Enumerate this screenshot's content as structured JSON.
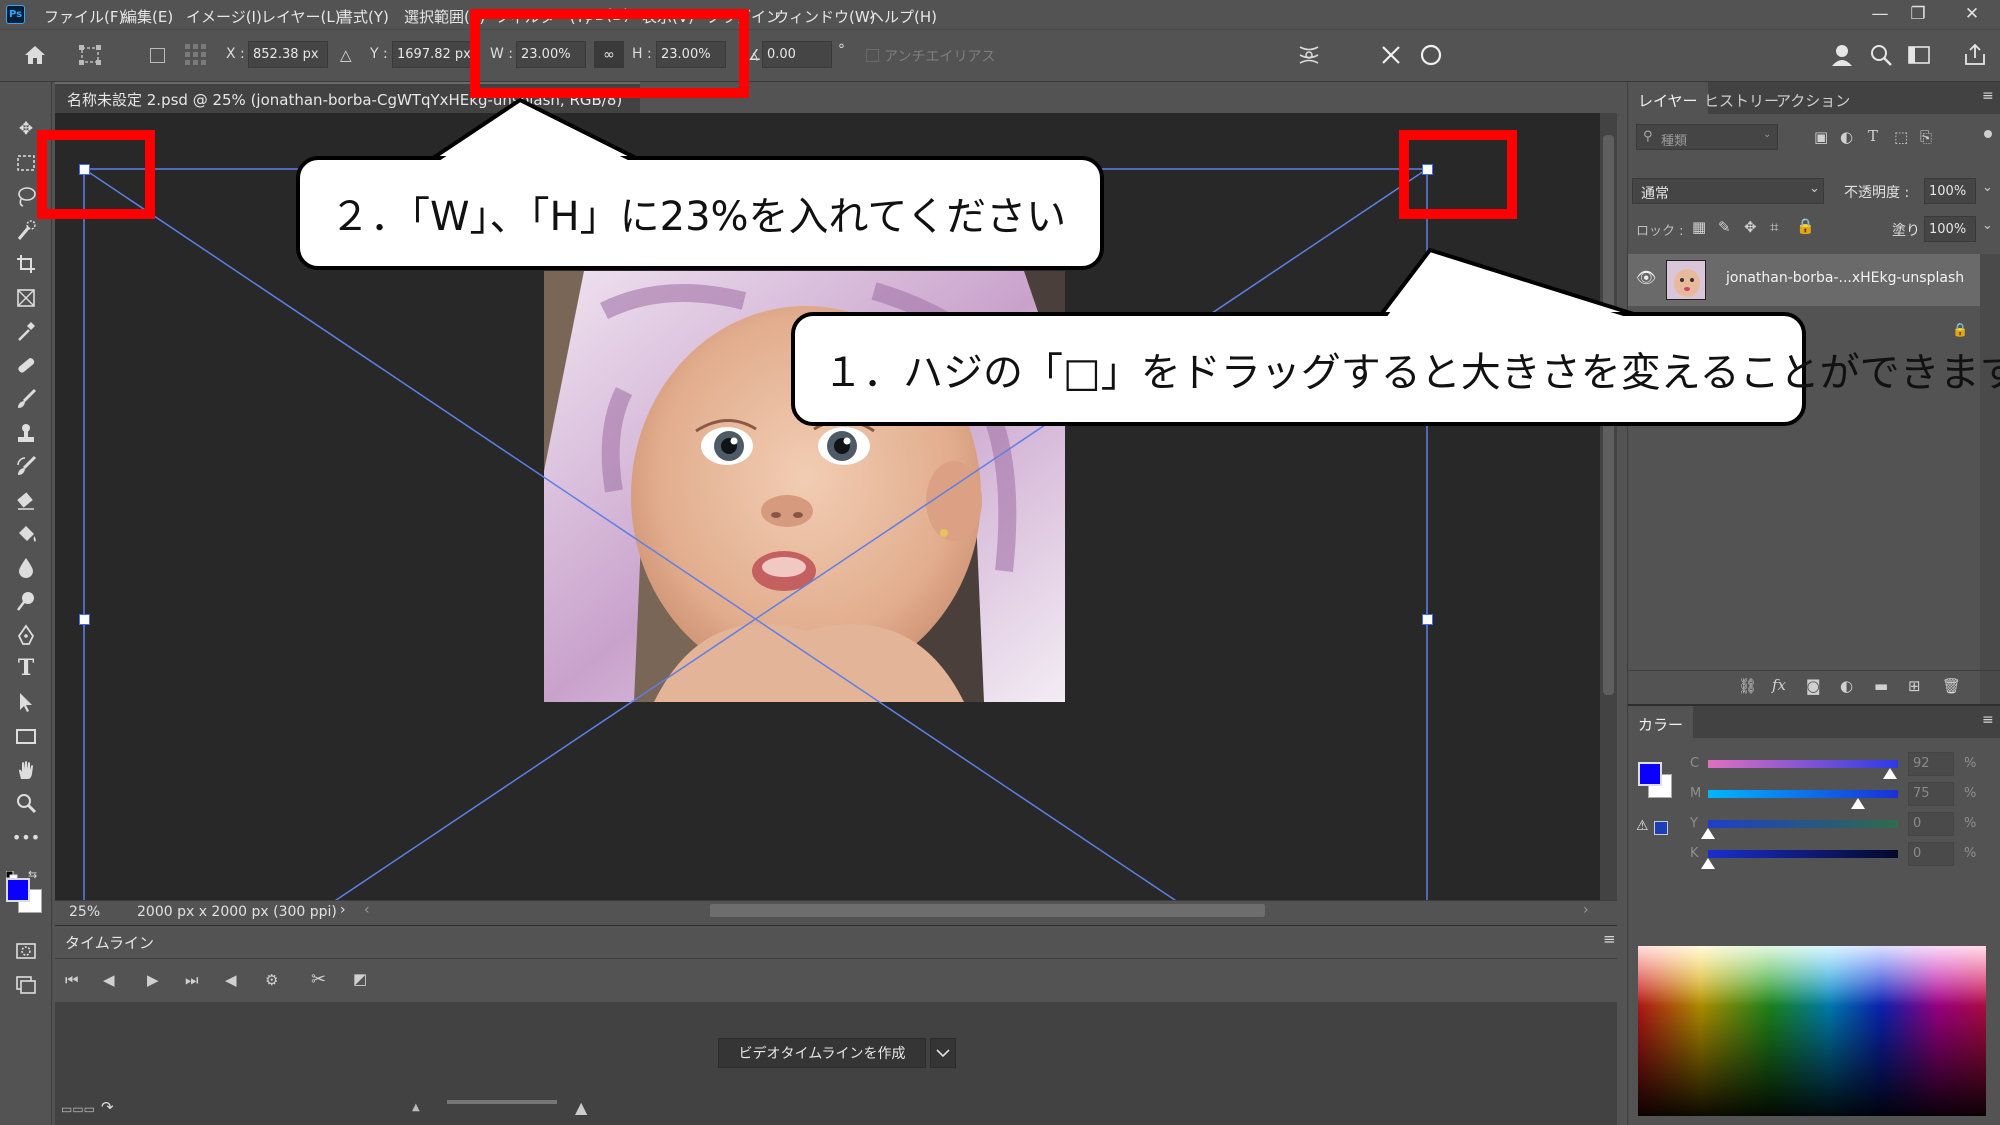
{
  "app": {
    "logo": "Ps"
  },
  "menu": [
    "ファイル(F)",
    "編集(E)",
    "イメージ(I)",
    "レイヤー(L)",
    "書式(Y)",
    "選択範囲(S)",
    "フィルター(T)",
    "3D(D)",
    "表示(V)",
    "プラグイン",
    "ウィンドウ(W)",
    "ヘルプ(H)"
  ],
  "window_controls": {
    "minimize": "—",
    "restore": "❐",
    "close": "✕"
  },
  "options": {
    "x_label": "X :",
    "x_value": "852.38 px",
    "y_label": "Y :",
    "y_value": "1697.82 px",
    "w_label": "W :",
    "w_value": "23.00%",
    "h_label": "H :",
    "h_value": "23.00%",
    "angle_value": "0.00",
    "degree": "°",
    "antialias": "アンチエイリアス"
  },
  "document": {
    "tab_title": "名称未設定 2.psd @ 25% (jonathan-borba-CgWTqYxHEkg-unsplash, RGB/8)",
    "zoom": "25%",
    "size_info": "2000 px x 2000 px (300 ppi)"
  },
  "timeline": {
    "title": "タイムライン",
    "create_button": "ビデオタイムラインを作成"
  },
  "layers_panel": {
    "tabs": [
      "レイヤー",
      "ヒストリー",
      "アクション"
    ],
    "filter_placeholder": "種類",
    "blend_mode": "通常",
    "opacity_label": "不透明度 :",
    "opacity_value": "100%",
    "lock_label": "ロック :",
    "fill_label": "塗り :",
    "fill_value": "100%",
    "layer_name": "jonathan-borba-...xHEkg-unsplash"
  },
  "color_panel": {
    "title": "カラー",
    "channels": [
      {
        "letter": "C",
        "value": "92",
        "level": 0.92
      },
      {
        "letter": "M",
        "value": "75",
        "level": 0.75
      },
      {
        "letter": "Y",
        "value": "0",
        "level": 0
      },
      {
        "letter": "K",
        "value": "0",
        "level": 0
      }
    ],
    "percent": "%",
    "foreground": "#0a00ff",
    "background": "#ffffff"
  },
  "annotations": {
    "callout_2": "２．「W」、「H」に23%を入れてください",
    "callout_1": "１．ハジの「□」をドラッグすると大きさを変えることができます"
  }
}
